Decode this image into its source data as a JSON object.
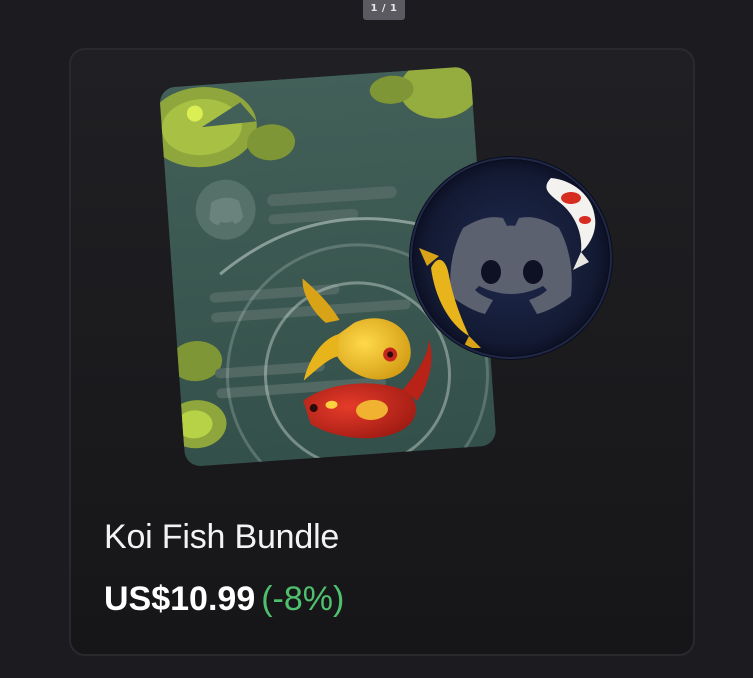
{
  "pager": {
    "label": "1 / 1"
  },
  "product": {
    "name": "Koi Fish Bundle",
    "price": "US$10.99",
    "discount": "(-8%)"
  },
  "icons": {
    "artwork": "koi-fish-profile-effect-card",
    "decoration": "koi-avatar-decoration",
    "discord_logo": "discord-logo-icon"
  },
  "colors": {
    "background": "#1c1c20",
    "card": "#1d1d21",
    "title": "#f2f3f5",
    "price": "#ffffff",
    "discount": "#4fc06e",
    "pond": "#3c5a52",
    "lily_pad": "#8aa03a",
    "koi_gold": "#e6b21a",
    "koi_red": "#c52a1e"
  }
}
